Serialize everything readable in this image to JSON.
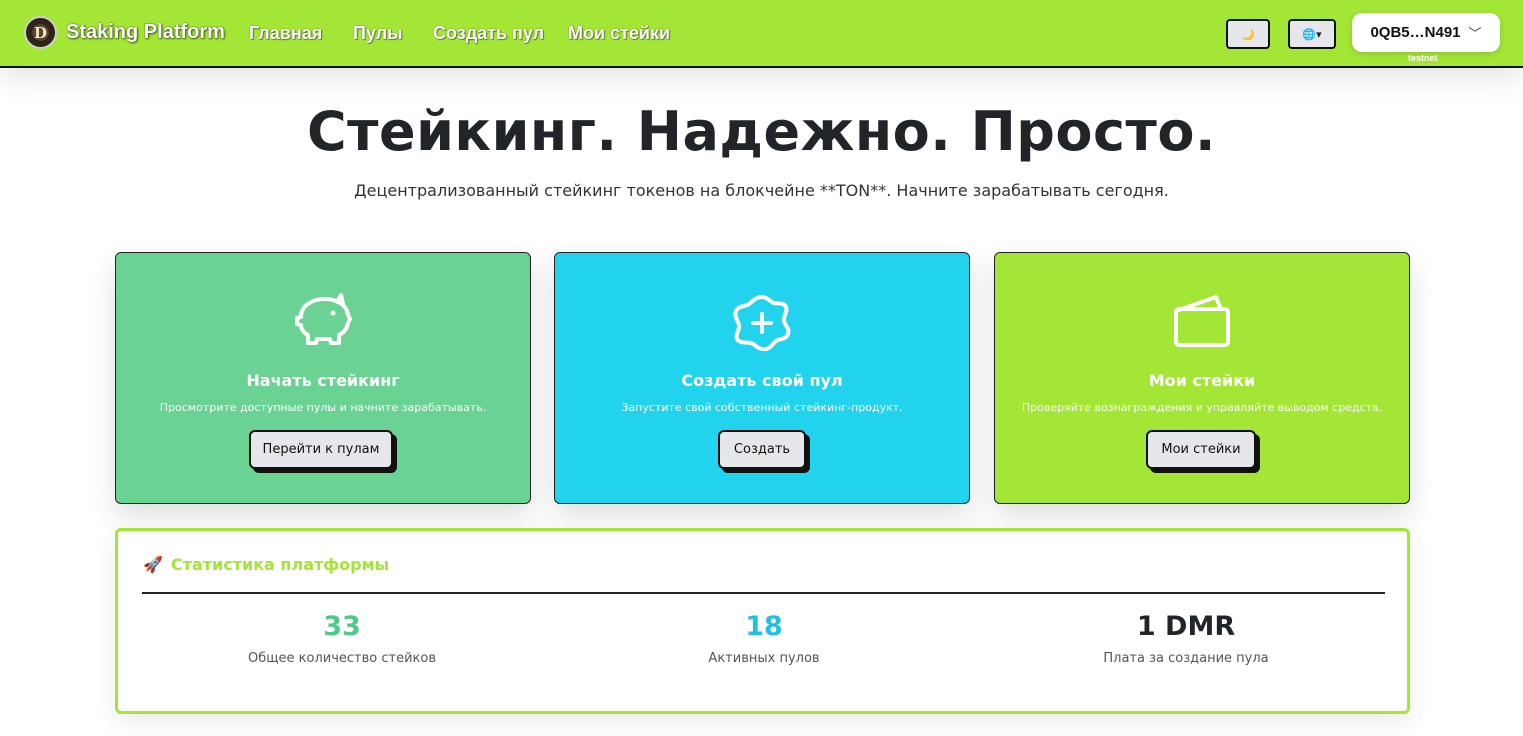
{
  "header": {
    "logo_letter": "D",
    "brand": "Staking Platform",
    "nav": [
      {
        "label": "Главная"
      },
      {
        "label": "Пулы"
      },
      {
        "label": "Создать пул"
      },
      {
        "label": "Мои стейки"
      }
    ],
    "theme_icon": "🌙",
    "lang_icon": "🌐▾",
    "wallet_address": "0QB5…N491",
    "wallet_chevron": "﹀",
    "network": "testnet"
  },
  "hero": {
    "title": "Стейкинг. Надежно. Просто.",
    "subtitle": "Децентрализованный стейкинг токенов на блокчейне **TON**. Начните зарабатывать сегодня."
  },
  "cards": [
    {
      "icon": "piggy-bank-icon",
      "color": "#6ad394",
      "title": "Начать стейкинг",
      "desc": "Просмотрите доступные пулы и начните зарабатывать.",
      "button": "Перейти к пулам"
    },
    {
      "icon": "plus-badge-icon",
      "color": "#22d3ee",
      "title": "Создать свой пул",
      "desc": "Запустите свой собственный стейкинг-продукт.",
      "button": "Создать"
    },
    {
      "icon": "wallet-icon",
      "color": "#a3e635",
      "title": "Мои стейки",
      "desc": "Проверяйте вознаграждения и управляйте выводом средств.",
      "button": "Мои стейки"
    }
  ],
  "stats": {
    "icon": "🚀",
    "title": "Статистика платформы",
    "items": [
      {
        "value": "33",
        "label": "Общее количество стейков",
        "color": "#4ec98a"
      },
      {
        "value": "18",
        "label": "Активных пулов",
        "color": "#22c0dc"
      },
      {
        "value": "1 DMR",
        "label": "Плата за создание пула",
        "color": "#212529"
      }
    ]
  },
  "colors": {
    "accent": "#a3e635",
    "green_card": "#6ad394",
    "cyan_card": "#22d3ee"
  }
}
